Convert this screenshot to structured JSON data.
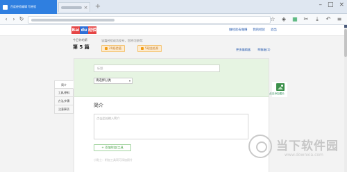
{
  "browser": {
    "active_tab_title": "百度经验编辑  写经验",
    "new_tab_glyph": "+",
    "window_controls": [
      "–",
      "□",
      "×"
    ],
    "nav": [
      "‹",
      "›",
      "↻"
    ],
    "tool_icons": [
      "star-icon",
      "shield-icon",
      "grid-icon",
      "scissors-icon",
      "download-icon",
      "undo-icon",
      "menu-icon"
    ],
    "tool_glyphs": [
      "☆",
      "◈",
      "▦",
      "✂",
      "⤓",
      "↶",
      "≡"
    ]
  },
  "header": {
    "logo_parts": [
      {
        "text": "Bai",
        "color": "#e64545"
      },
      {
        "text": "du",
        "color": "#2f6fd6"
      },
      {
        "text": "经验",
        "color": "#e64545"
      }
    ],
    "links": [
      "做经验去做赚",
      "我的经验",
      "退出"
    ]
  },
  "summary": {
    "today_label": "今日你的第",
    "count": "第 5 篇",
    "tip": "该篇经验成功发布，您将可获得：",
    "badges": [
      "20经验值",
      "5现金抵扣"
    ],
    "right_links": [
      "更多编辑器",
      "草稿箱(1)"
    ]
  },
  "editor": {
    "title_placeholder": "标题",
    "category_value": "请选择分类",
    "category_arrow": "▾",
    "intro_heading": "简介",
    "intro_placeholder": "点击此处输入简介",
    "add_tools_label": "+ 添加附加/工具",
    "hint": "小贴士：附加工具项可添加照片"
  },
  "sidenav": {
    "items": [
      "简介",
      "工具/原料",
      "方法/步骤",
      "注意事项"
    ]
  },
  "image_widget": {
    "label": "点击添加图片"
  },
  "watermark": {
    "brand": "当下软件园",
    "url": "www.downxia.com"
  }
}
